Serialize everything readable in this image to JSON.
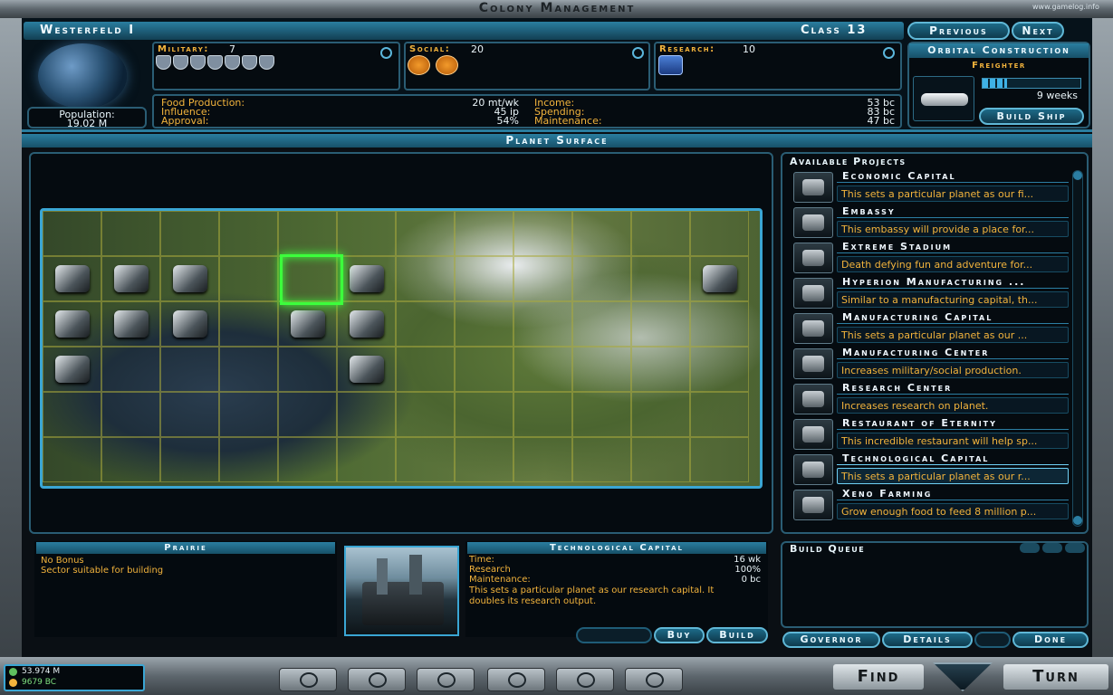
{
  "window": {
    "title": "Colony Management",
    "watermark": "www.gamelog.info"
  },
  "planet": {
    "name": "Westerfeld I",
    "class": "Class 13",
    "population_label": "Population:",
    "population_value": "19.02 M"
  },
  "nav": {
    "previous": "Previous",
    "next": "Next"
  },
  "military": {
    "label": "Military:",
    "value": "7",
    "shields": 7
  },
  "social": {
    "label": "Social:",
    "value": "20",
    "icons": 2
  },
  "research": {
    "label": "Research:",
    "value": "10"
  },
  "stats": {
    "food_label": "Food Production:",
    "food_value": "20 mt/wk",
    "influence_label": "Influence:",
    "influence_value": "45 ip",
    "approval_label": "Approval:",
    "approval_value": "54%",
    "income_label": "Income:",
    "income_value": "53 bc",
    "spending_label": "Spending:",
    "spending_value": "83 bc",
    "maintenance_label": "Maintenance:",
    "maintenance_value": "47 bc"
  },
  "orbital": {
    "title": "Orbital Construction",
    "item": "Freighter",
    "progress": 0.25,
    "time": "9 weeks",
    "build_ship": "Build Ship"
  },
  "surface": {
    "title": "Planet Surface"
  },
  "tile": {
    "title": "Prairie",
    "line1": "No Bonus",
    "line2": "Sector suitable for building"
  },
  "selected": {
    "title": "Technological Capital",
    "time_label": "Time:",
    "time_value": "16 wk",
    "research_label": "Research",
    "research_value": "100%",
    "maintenance_label": "Maintenance:",
    "maintenance_value": "0 bc",
    "description": "This sets a particular planet as our research capital. It doubles its research output.",
    "buy": "Buy",
    "build": "Build"
  },
  "projects": {
    "title": "Available Projects",
    "items": [
      {
        "name": "Economic Capital",
        "desc": "This sets a particular planet as our fi..."
      },
      {
        "name": "Embassy",
        "desc": "This embassy will provide a place for..."
      },
      {
        "name": "Extreme Stadium",
        "desc": "Death defying fun and adventure for..."
      },
      {
        "name": "Hyperion Manufacturing ...",
        "desc": "Similar to a manufacturing capital, th..."
      },
      {
        "name": "Manufacturing Capital",
        "desc": "This sets a particular planet as our ..."
      },
      {
        "name": "Manufacturing Center",
        "desc": "Increases military/social production."
      },
      {
        "name": "Research Center",
        "desc": "Increases research on planet."
      },
      {
        "name": "Restaurant of Eternity",
        "desc": "This incredible restaurant will help sp..."
      },
      {
        "name": "Technological Capital",
        "desc": "This sets a particular planet as our r..."
      },
      {
        "name": "Xeno Farming",
        "desc": "Grow enough food to feed 8 million p..."
      }
    ]
  },
  "queue": {
    "title": "Build Queue"
  },
  "bottom_buttons": {
    "governor": "Governor",
    "details": "Details",
    "done": "Done"
  },
  "empire": {
    "population": "53.974 M",
    "credits": "9679 BC"
  },
  "main_bar": {
    "find": "Find",
    "turn": "Turn"
  },
  "colors": {
    "accent": "#2a7ea0",
    "label_orange": "#f2b33c",
    "selection_green": "#3cff3c"
  }
}
